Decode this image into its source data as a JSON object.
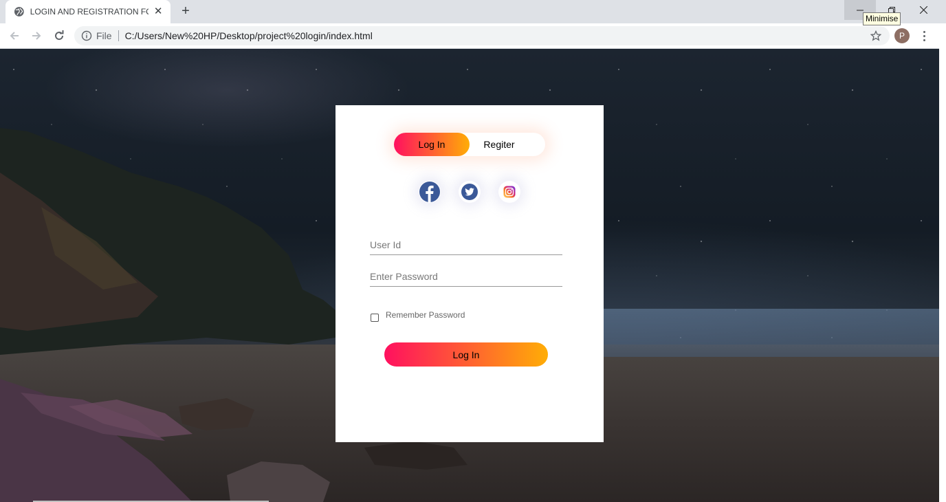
{
  "browser": {
    "tab_title": "LOGIN AND REGISTRATION FORM",
    "new_tab_label": "+",
    "tab_close": "✕",
    "tooltip": "Minimise",
    "omnibox_scheme": "File",
    "url": "C:/Users/New%20HP/Desktop/project%20login/index.html",
    "avatar_letter": "P"
  },
  "form": {
    "switch": {
      "login_label": "Log In",
      "register_label": "Regiter"
    },
    "social": [
      "facebook-icon",
      "twitter-icon",
      "instagram-icon"
    ],
    "user_id_placeholder": "User Id",
    "password_placeholder": "Enter Password",
    "remember_label": "Remember Password",
    "submit_label": "Log In"
  },
  "colors": {
    "gradient_start": "#ff105f",
    "gradient_end": "#ffad06",
    "facebook": "#3b5998",
    "twitter": "#1da1f2"
  }
}
